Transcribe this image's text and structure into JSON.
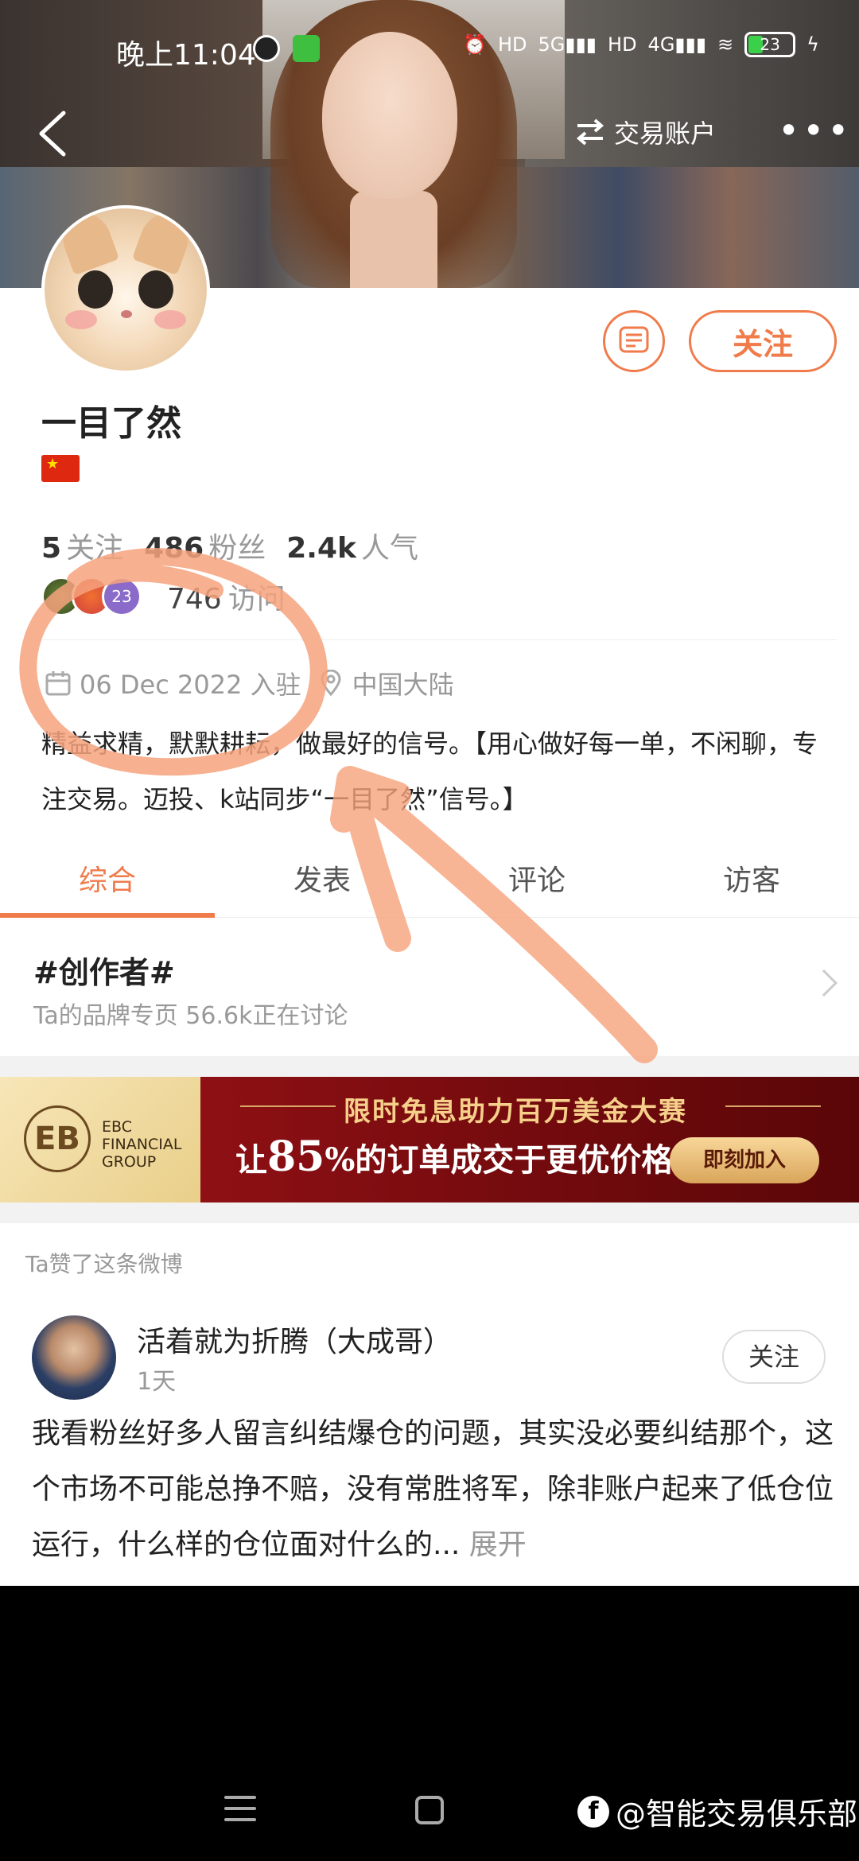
{
  "status": {
    "time": "晚上11:04",
    "battery": "23"
  },
  "header": {
    "trade_account": "交易账户",
    "more": "•••"
  },
  "profile": {
    "follow_label": "关注",
    "username": "一目了然",
    "stats": [
      {
        "value": "5",
        "label": "关注"
      },
      {
        "value": "486",
        "label": "粉丝"
      },
      {
        "value": "2.4k",
        "label": "人气"
      }
    ],
    "visitor_badge": "23",
    "visits_value": "746",
    "visits_label": "访问",
    "joined": "06 Dec 2022 入驻",
    "location": "中国大陆",
    "bio": "精益求精，默默耕耘，做最好的信号。【用心做好每一单，不闲聊，专注交易。迈投、k站同步“一目了然”信号。】"
  },
  "tabs": [
    "综合",
    "发表",
    "评论",
    "访客"
  ],
  "topic": {
    "title": "#创作者#",
    "subtitle": "Ta的品牌专页  56.6k正在讨论"
  },
  "ad": {
    "logo_mark": "EB",
    "logo_line1": "EBC",
    "logo_line2": "FINANCIAL",
    "logo_line3": "GROUP",
    "headline": "限时免息助力百万美金大赛",
    "line_pre": "让",
    "line_num": "85",
    "line_post": "%的订单成交于更优价格",
    "cta": "即刻加入"
  },
  "feed": {
    "liked_label": "Ta赞了这条微博",
    "post": {
      "author": "活着就为折腾（大成哥）",
      "time": "1天",
      "follow": "关注",
      "text": "我看粉丝好多人留言纠结爆仓的问题，其实没必要纠结那个，这个市场不可能总挣不赔，没有常胜将军，除非账户起来了低仓位运行，什么样的仓位面对什么的...",
      "expand": "展开"
    }
  },
  "watermark": "@智能交易俱乐部",
  "colors": {
    "accent": "#f07b4b",
    "annotation": "#f6a27c"
  }
}
